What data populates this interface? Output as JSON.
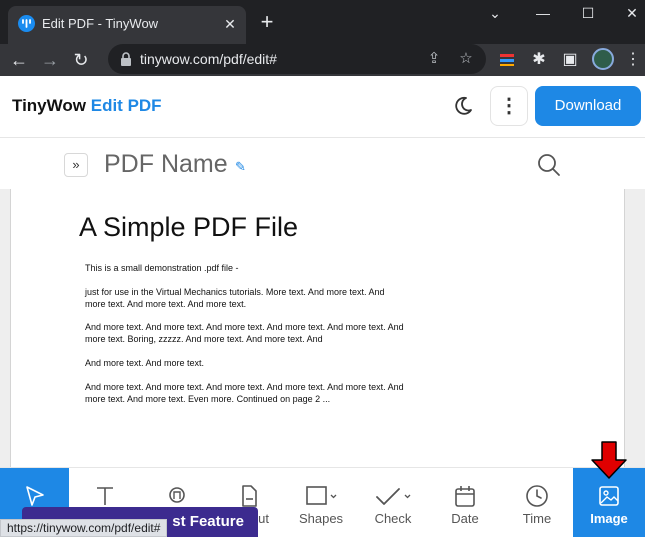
{
  "browser": {
    "tab_title": "Edit PDF - TinyWow",
    "url": "tinywow.com/pdf/edit#",
    "status_url": "https://tinywow.com/pdf/edit#"
  },
  "header": {
    "brand_name": "TinyWow",
    "brand_tool": "Edit PDF",
    "download_label": "Download"
  },
  "document": {
    "name": "PDF Name",
    "title": "A Simple PDF File",
    "paragraphs": [
      "This is a small demonstration .pdf file -",
      "just for use in the Virtual Mechanics tutorials. More text. And more text. And more text. And more text. And more text.",
      "And more text. And more text. And more text. And more text. And more text. And more text. Boring, zzzzz. And more text. And more text. And",
      "And more text. And more text.",
      "And more text. And more text. And more text. And more text. And more text. And more text. And more text. Even more. Continued on page 2 ..."
    ]
  },
  "tools": [
    {
      "label": "S",
      "icon": "cursor-icon"
    },
    {
      "label": "",
      "icon": "text-icon"
    },
    {
      "label": "",
      "icon": "sign-icon"
    },
    {
      "label": "out",
      "icon": "whiteout-icon"
    },
    {
      "label": "Shapes",
      "icon": "square-icon"
    },
    {
      "label": "Check",
      "icon": "check-icon"
    },
    {
      "label": "Date",
      "icon": "calendar-icon"
    },
    {
      "label": "Time",
      "icon": "clock-icon"
    },
    {
      "label": "Image",
      "icon": "image-icon"
    }
  ],
  "banner": {
    "label": "st Feature"
  },
  "colors": {
    "accent": "#1e88e5",
    "arrow": "#e00000",
    "banner": "#3c2b8f"
  }
}
